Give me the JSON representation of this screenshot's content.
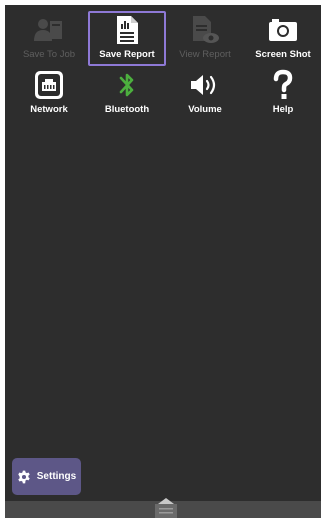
{
  "toolbar": {
    "items": [
      {
        "label": "Save To Job",
        "icon": "save-to-job-icon",
        "enabled": false
      },
      {
        "label": "Save Report",
        "icon": "report-document-icon",
        "enabled": true,
        "selected": true
      },
      {
        "label": "View Report",
        "icon": "view-report-icon",
        "enabled": false
      },
      {
        "label": "Screen Shot",
        "icon": "camera-icon",
        "enabled": true
      },
      {
        "label": "Network",
        "icon": "ethernet-port-icon",
        "enabled": true
      },
      {
        "label": "Bluetooth",
        "icon": "bluetooth-icon",
        "enabled": true
      },
      {
        "label": "Volume",
        "icon": "speaker-icon",
        "enabled": true
      },
      {
        "label": "Help",
        "icon": "question-mark-icon",
        "enabled": true
      }
    ]
  },
  "settings": {
    "label": "Settings",
    "icon": "gear-icon"
  },
  "colors": {
    "background": "#2d2d2d",
    "selection_outline": "#8e79d6",
    "settings_button": "#5d5787",
    "bluetooth": "#4caf3e",
    "disabled": "#5f5f5f"
  }
}
